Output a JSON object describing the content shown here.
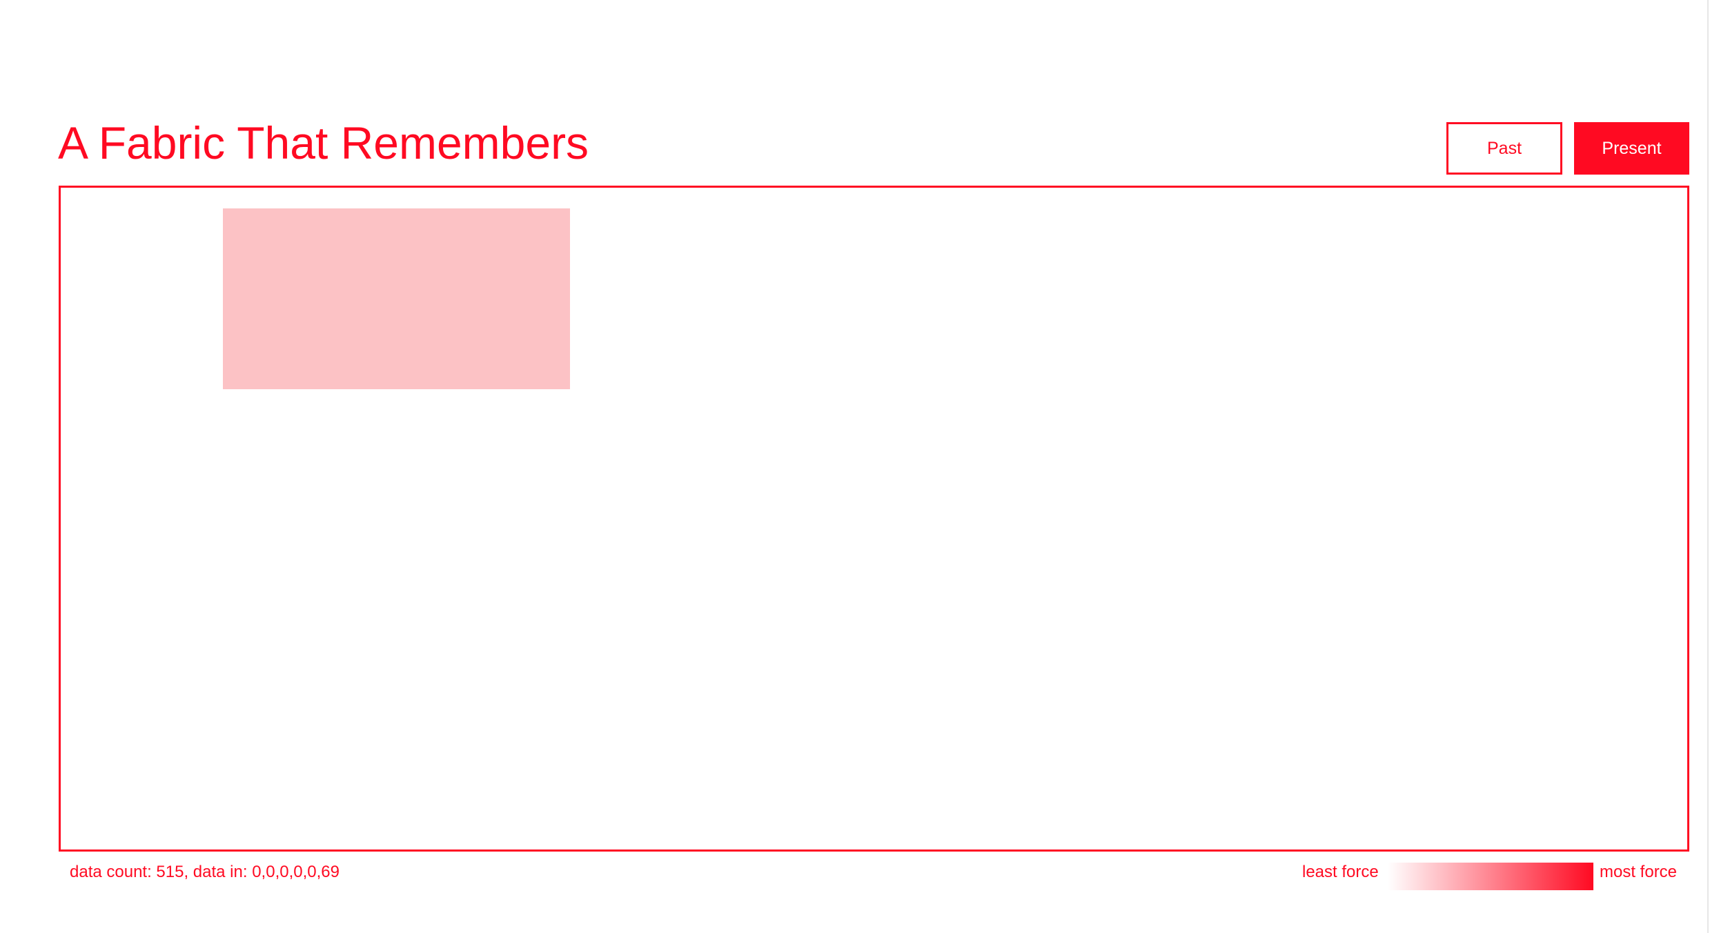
{
  "header": {
    "title": "A Fabric That Remembers"
  },
  "view_toggle": {
    "past_label": "Past",
    "present_label": "Present",
    "selected": "Present"
  },
  "status": {
    "data_count_text": "data count: 515, data in: 0,0,0,0,0,69"
  },
  "legend": {
    "min_label": "least force",
    "max_label": "most force"
  },
  "colors": {
    "accent": "#ff0a22",
    "patch_fill": "#fcc2c5",
    "background": "#ffffff"
  }
}
